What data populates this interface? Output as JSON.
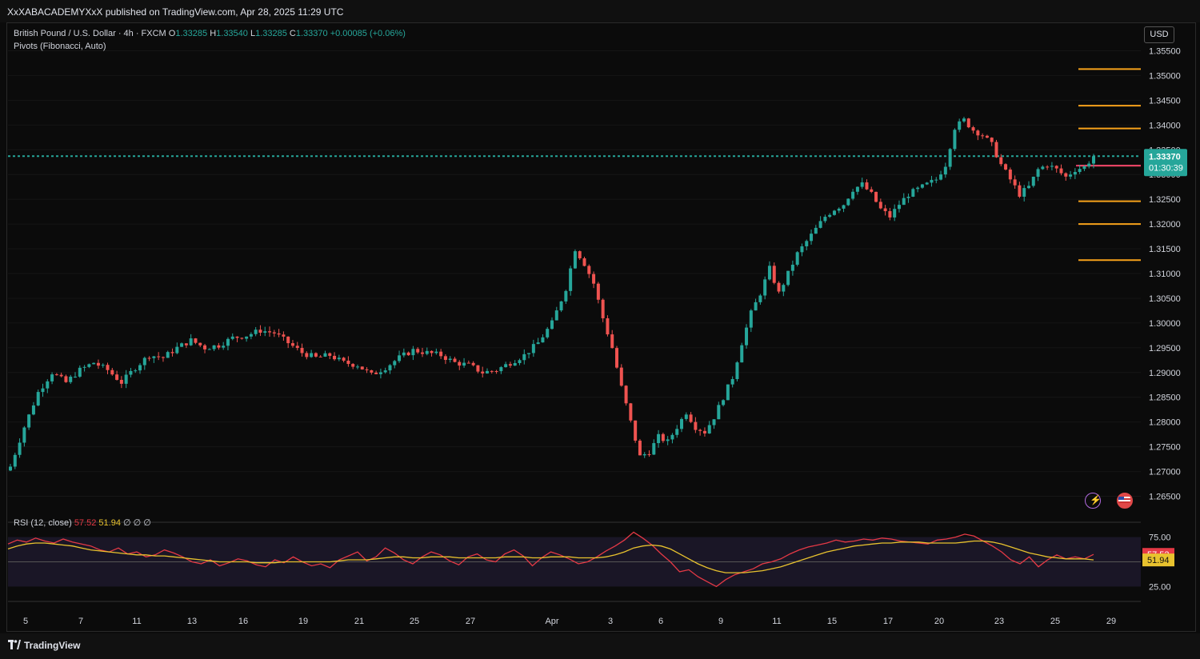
{
  "header": {
    "publisher": "XxXABACADEMYXxX published on TradingView.com, Apr 28, 2025 11:29 UTC"
  },
  "legend": {
    "symbol": "British Pound / U.S. Dollar · 4h · FXCM",
    "open_label": "O",
    "open": "1.33285",
    "high_label": "H",
    "high": "1.33540",
    "low_label": "L",
    "low": "1.33285",
    "close_label": "C",
    "close": "1.33370",
    "change": "+0.00085 (+0.06%)",
    "indicator": "Pivots (Fibonacci, Auto)"
  },
  "currency_button": "USD",
  "price_tag": {
    "price": "1.33370",
    "countdown": "01:30:39"
  },
  "rsi_legend": {
    "name": "RSI (12, close)",
    "rsi": "57.52",
    "ma": "51.94",
    "extra": "∅ ∅ ∅"
  },
  "footer": {
    "brand": "TradingView"
  },
  "icons": [
    "bolt-icon",
    "us-flag-icon",
    "tradingview-logo-icon"
  ],
  "colors": {
    "up": "#26a69a",
    "down": "#ef5350",
    "pivot": "#f7a21b",
    "rsi": "#e53945",
    "rsi_ma": "#e8c22e",
    "current_price": "#26a69a"
  },
  "chart_data": [
    {
      "type": "candlestick",
      "symbol": "GBPUSD",
      "timeframe": "4h",
      "y_ticks": [
        "1.35500",
        "1.35000",
        "1.34500",
        "1.34000",
        "1.33500",
        "1.33000",
        "1.32500",
        "1.32000",
        "1.31500",
        "1.31000",
        "1.30500",
        "1.30000",
        "1.29500",
        "1.29000",
        "1.28500",
        "1.28000",
        "1.27500",
        "1.27000",
        "1.26500"
      ],
      "ylim": [
        1.2625,
        1.3575
      ],
      "x_ticks": [
        "5",
        "7",
        "11",
        "13",
        "16",
        "19",
        "21",
        "25",
        "27",
        "Apr",
        "3",
        "6",
        "9",
        "11",
        "15",
        "17",
        "20",
        "23",
        "25",
        "29"
      ],
      "price_path": [
        [
          0,
          1.271
        ],
        [
          3,
          1.279
        ],
        [
          6,
          1.286
        ],
        [
          9,
          1.29
        ],
        [
          12,
          1.288
        ],
        [
          15,
          1.2905
        ],
        [
          18,
          1.292
        ],
        [
          21,
          1.2905
        ],
        [
          24,
          1.288
        ],
        [
          27,
          1.291
        ],
        [
          30,
          1.2935
        ],
        [
          33,
          1.293
        ],
        [
          36,
          1.295
        ],
        [
          39,
          1.2965
        ],
        [
          42,
          1.295
        ],
        [
          45,
          1.2955
        ],
        [
          48,
          1.297
        ],
        [
          51,
          1.2975
        ],
        [
          54,
          1.2985
        ],
        [
          57,
          1.298
        ],
        [
          60,
          1.296
        ],
        [
          63,
          1.294
        ],
        [
          66,
          1.293
        ],
        [
          69,
          1.2935
        ],
        [
          72,
          1.292
        ],
        [
          75,
          1.2915
        ],
        [
          78,
          1.2895
        ],
        [
          81,
          1.291
        ],
        [
          84,
          1.293
        ],
        [
          87,
          1.2945
        ],
        [
          90,
          1.294
        ],
        [
          93,
          1.2935
        ],
        [
          96,
          1.292
        ],
        [
          99,
          1.2915
        ],
        [
          102,
          1.29
        ],
        [
          105,
          1.2905
        ],
        [
          108,
          1.292
        ],
        [
          111,
          1.2935
        ],
        [
          114,
          1.296
        ],
        [
          117,
          1.3
        ],
        [
          120,
          1.307
        ],
        [
          122,
          1.315
        ],
        [
          124,
          1.312
        ],
        [
          126,
          1.308
        ],
        [
          128,
          1.301
        ],
        [
          130,
          1.295
        ],
        [
          132,
          1.287
        ],
        [
          134,
          1.28
        ],
        [
          136,
          1.273
        ],
        [
          138,
          1.274
        ],
        [
          140,
          1.277
        ],
        [
          142,
          1.276
        ],
        [
          144,
          1.279
        ],
        [
          146,
          1.282
        ],
        [
          148,
          1.279
        ],
        [
          150,
          1.278
        ],
        [
          152,
          1.281
        ],
        [
          154,
          1.285
        ],
        [
          156,
          1.289
        ],
        [
          158,
          1.296
        ],
        [
          160,
          1.302
        ],
        [
          162,
          1.306
        ],
        [
          164,
          1.311
        ],
        [
          166,
          1.306
        ],
        [
          168,
          1.31
        ],
        [
          170,
          1.314
        ],
        [
          172,
          1.3165
        ],
        [
          174,
          1.319
        ],
        [
          176,
          1.3215
        ],
        [
          178,
          1.323
        ],
        [
          180,
          1.324
        ],
        [
          182,
          1.327
        ],
        [
          184,
          1.328
        ],
        [
          186,
          1.326
        ],
        [
          188,
          1.323
        ],
        [
          190,
          1.3215
        ],
        [
          192,
          1.324
        ],
        [
          194,
          1.326
        ],
        [
          196,
          1.327
        ],
        [
          198,
          1.328
        ],
        [
          200,
          1.329
        ],
        [
          202,
          1.332
        ],
        [
          204,
          1.3395
        ],
        [
          206,
          1.341
        ],
        [
          208,
          1.339
        ],
        [
          210,
          1.338
        ],
        [
          212,
          1.336
        ],
        [
          214,
          1.332
        ],
        [
          216,
          1.329
        ],
        [
          218,
          1.326
        ],
        [
          220,
          1.3275
        ],
        [
          222,
          1.331
        ],
        [
          224,
          1.332
        ],
        [
          226,
          1.331
        ],
        [
          228,
          1.3295
        ],
        [
          230,
          1.331
        ],
        [
          232,
          1.3315
        ],
        [
          234,
          1.3337
        ]
      ],
      "pivot_levels": [
        1.3513,
        1.3439,
        1.3393,
        1.3318,
        1.3246,
        1.32,
        1.3127
      ],
      "current_price": 1.3337
    },
    {
      "type": "line",
      "title": "RSI (12, close)",
      "y_ticks": [
        "75.00",
        "25.00"
      ],
      "ylim": [
        10,
        90
      ],
      "midline": 50,
      "series": [
        {
          "name": "RSI",
          "values": [
            68,
            72,
            70,
            74,
            71,
            69,
            73,
            70,
            68,
            66,
            62,
            60,
            64,
            58,
            60,
            55,
            57,
            62,
            59,
            55,
            50,
            48,
            52,
            46,
            49,
            53,
            51,
            47,
            45,
            52,
            49,
            55,
            50,
            46,
            48,
            44,
            52,
            56,
            60,
            51,
            55,
            64,
            59,
            52,
            48,
            55,
            60,
            57,
            51,
            47,
            55,
            58,
            52,
            50,
            58,
            62,
            56,
            46,
            54,
            60,
            57,
            53,
            48,
            50,
            55,
            61,
            66,
            72,
            80,
            74,
            67,
            58,
            50,
            40,
            42,
            35,
            30,
            25,
            32,
            37,
            40,
            43,
            48,
            50,
            53,
            58,
            62,
            65,
            67,
            69,
            72,
            70,
            71,
            73,
            72,
            74,
            73,
            71,
            70,
            69,
            68,
            72,
            73,
            75,
            78,
            76,
            71,
            66,
            60,
            52,
            48,
            55,
            45,
            52,
            57,
            53,
            55,
            53,
            57.5
          ]
        },
        {
          "name": "MA",
          "values": [
            63,
            66,
            68,
            69,
            69,
            68,
            67,
            66,
            64,
            62,
            61,
            60,
            59,
            58,
            57,
            57,
            56,
            56,
            55,
            54,
            53,
            52,
            51,
            50,
            50,
            50,
            50,
            49,
            49,
            49,
            50,
            50,
            50,
            50,
            50,
            50,
            51,
            52,
            52,
            52,
            53,
            54,
            55,
            55,
            54,
            54,
            55,
            55,
            55,
            54,
            54,
            54,
            54,
            54,
            55,
            55,
            55,
            54,
            54,
            55,
            55,
            55,
            54,
            54,
            54,
            55,
            57,
            60,
            64,
            66,
            67,
            66,
            63,
            58,
            53,
            48,
            44,
            41,
            39,
            39,
            39,
            40,
            41,
            43,
            45,
            48,
            51,
            54,
            57,
            60,
            62,
            64,
            66,
            67,
            68,
            69,
            69,
            70,
            70,
            70,
            69,
            69,
            69,
            69,
            70,
            71,
            71,
            70,
            68,
            65,
            62,
            59,
            57,
            55,
            54,
            53,
            53,
            53,
            51.9
          ]
        }
      ]
    }
  ]
}
